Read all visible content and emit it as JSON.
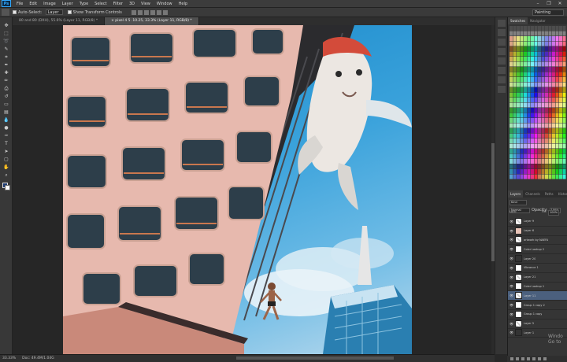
{
  "app": {
    "logo": "Ps"
  },
  "menu": [
    "File",
    "Edit",
    "Image",
    "Layer",
    "Type",
    "Select",
    "Filter",
    "3D",
    "View",
    "Window",
    "Help"
  ],
  "window_controls": [
    "–",
    "❐",
    "✕"
  ],
  "options": {
    "auto_select_label": "Auto-Select:",
    "auto_select_value": "Layer",
    "show_transform_label": "Show Transform Controls",
    "workspace": "Painting"
  },
  "tabs": [
    {
      "label": "80 and 80 (DXH), 55.6% (Layer 11, RGB/8) *",
      "active": false
    },
    {
      "label": "× pixel 4 5 .10.25, 33.3% (Layer 11, RGB/8) *",
      "active": true
    }
  ],
  "status": {
    "zoom": "33.33%",
    "doc": "Doc: 49.4M/1.04G"
  },
  "panels": {
    "top_tabs": [
      "Swatches",
      "Navigator"
    ],
    "layer_tabs": [
      "Layers",
      "Channels",
      "Paths",
      "History"
    ],
    "kind_label": "Kind",
    "blend_mode": "Normal",
    "opacity_label": "Opacity:",
    "opacity_value": "100%",
    "lock_label": "Lock:",
    "fill_label": "Fill:",
    "fill_value": "100%"
  },
  "layers": [
    {
      "name": "Layer 9",
      "thumb": "check",
      "selected": false
    },
    {
      "name": "Layer 6",
      "thumb": "pink",
      "selected": false
    },
    {
      "name": "artwork by NAEFA",
      "thumb": "check",
      "selected": false
    },
    {
      "name": "Color Lookup 2",
      "thumb": "mask",
      "selected": false
    },
    {
      "name": "Layer 20",
      "thumb": "dark",
      "selected": false
    },
    {
      "name": "Vibrance 1",
      "thumb": "mask",
      "selected": false
    },
    {
      "name": "Layer 21",
      "thumb": "check",
      "selected": false
    },
    {
      "name": "Color Lookup 1",
      "thumb": "mask",
      "selected": false
    },
    {
      "name": "Layer 11",
      "thumb": "check",
      "selected": true
    },
    {
      "name": "Group 1 copy 2",
      "thumb": "mask",
      "selected": false
    },
    {
      "name": "Group 1 copy",
      "thumb": "mask",
      "selected": false
    },
    {
      "name": "Layer 5",
      "thumb": "check",
      "selected": false
    },
    {
      "name": "Layer 1",
      "thumb": "dark",
      "selected": false
    }
  ],
  "watermark": [
    "Windo",
    "Go to"
  ],
  "colors": {
    "sky": "#3aa2db",
    "building": "#e7b9ae",
    "selected_layer": "#4b607e",
    "ui_dark": "#282828"
  }
}
